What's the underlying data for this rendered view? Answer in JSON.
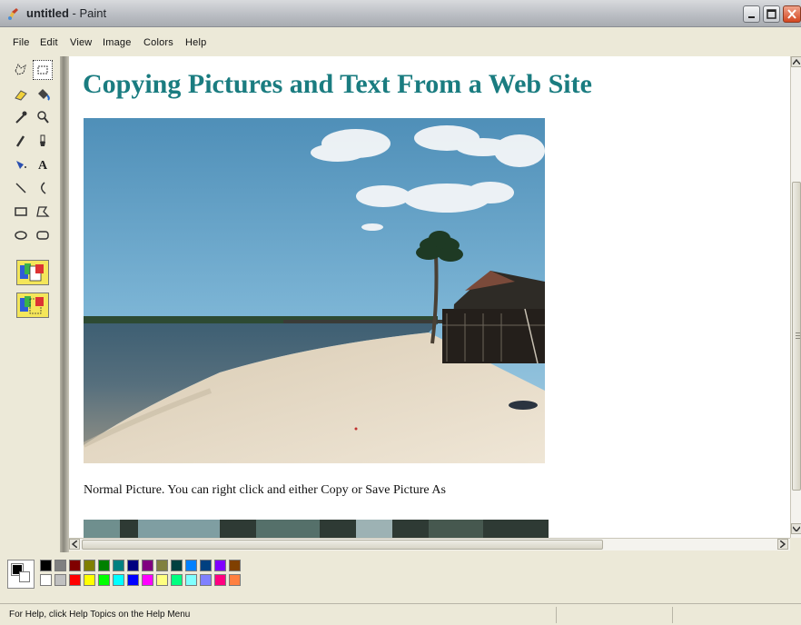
{
  "window": {
    "title": "untitled",
    "app_name": "Paint",
    "title_separator": " - "
  },
  "menu": {
    "items": [
      "File",
      "Edit",
      "View",
      "Image",
      "Colors",
      "Help"
    ]
  },
  "tools": [
    "free-form-select",
    "select",
    "eraser",
    "fill-with-color",
    "pick-color",
    "magnifier",
    "pencil",
    "brush",
    "airbrush",
    "text",
    "line",
    "curve",
    "rectangle",
    "polygon",
    "ellipse",
    "rounded-rectangle"
  ],
  "canvas": {
    "heading": "Copying Pictures and Text From a Web Site",
    "caption": "Normal Picture. You can right click and either Copy or Save Picture As",
    "heading_color": "#1a7c80"
  },
  "palette": {
    "top": [
      "#000000",
      "#808080",
      "#800000",
      "#808000",
      "#008000",
      "#008080",
      "#000080",
      "#800080",
      "#808040",
      "#004040",
      "#0080ff",
      "#004080",
      "#8000ff",
      "#804000"
    ],
    "bottom": [
      "#ffffff",
      "#c0c0c0",
      "#ff0000",
      "#ffff00",
      "#00ff00",
      "#00ffff",
      "#0000ff",
      "#ff00ff",
      "#ffff80",
      "#00ff80",
      "#80ffff",
      "#8080ff",
      "#ff0080",
      "#ff8040"
    ],
    "foreground": "#000000",
    "background": "#ffffff"
  },
  "status": {
    "text": "For Help, click Help Topics on the Help Menu"
  }
}
